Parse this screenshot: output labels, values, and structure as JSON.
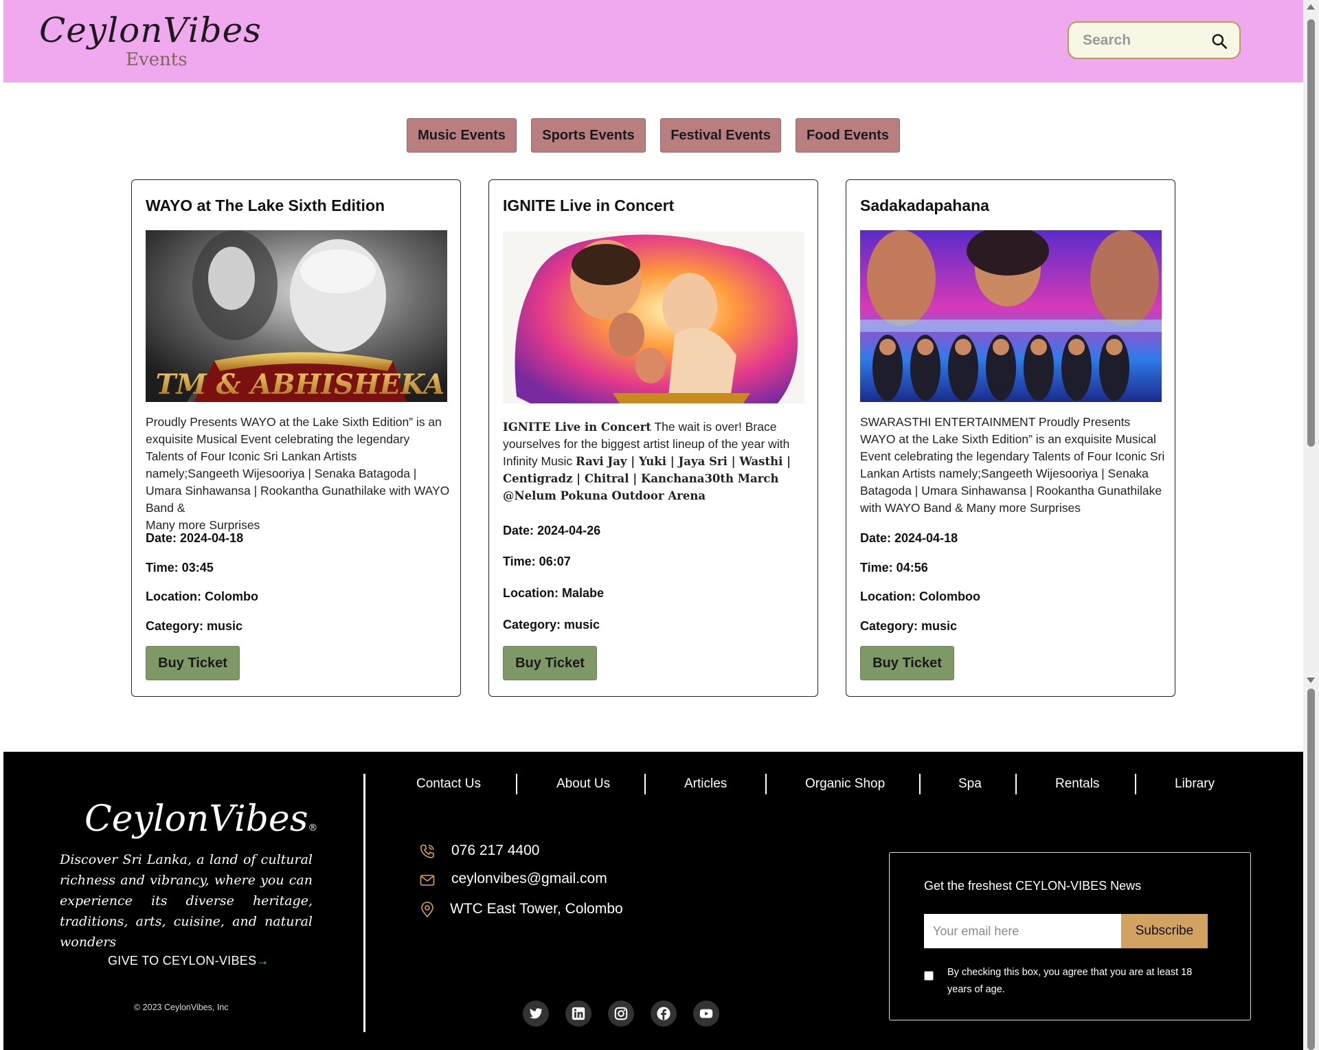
{
  "header": {
    "brand": "CeylonVibes",
    "brand_sub": "Events",
    "search_placeholder": "Search"
  },
  "categories": [
    {
      "label": "Music Events"
    },
    {
      "label": "Sports Events"
    },
    {
      "label": "Festival Events"
    },
    {
      "label": "Food Events"
    }
  ],
  "events": [
    {
      "title": "WAYO at The Lake Sixth Edition",
      "image_caption": "TM & ABHISHEKA",
      "description": "Proudly Presents WAYO at the Lake Sixth Edition” is an exquisite Musical Event celebrating the legendary Talents of Four Iconic Sri Lankan Artists namely;Sangeeth Wijesooriya | Senaka Batagoda | Umara Sinhawansa | Rookantha Gunathilake with WAYO Band &",
      "description_tail": "Many more Surprises",
      "date": "Date: 2024-04-18",
      "time": "Time: 03:45",
      "location": "Location: Colombo",
      "category": "Category: music",
      "button": "Buy Ticket"
    },
    {
      "title": "IGNITE Live in Concert",
      "desc_lead_bold": "IGNITE Live in Concert",
      "desc_lead": " The wait is over! Brace yourselves for the biggest artist lineup of the year with Infinity Music ",
      "desc_bold": "Ravi Jay | Yuki | Jaya Sri | Wasthi | Centigradz | Chitral | Kanchana30th March @Nelum Pokuna Outdoor Arena",
      "date": "Date: 2024-04-26",
      "time": "Time: 06:07",
      "location": "Location: Malabe",
      "category": "Category: music",
      "button": "Buy Ticket"
    },
    {
      "title": "Sadakadapahana",
      "description": "SWARASTHI ENTERTAINMENT Proudly Presents WAYO at the Lake Sixth Edition” is an exquisite Musical Event celebrating the legendary Talents of Four Iconic Sri Lankan Artists namely;Sangeeth Wijesooriya | Senaka Batagoda | Umara Sinhawansa | Rookantha Gunathilake with WAYO Band & Many more Surprises",
      "date": "Date: 2024-04-18",
      "time": "Time: 04:56",
      "location": "Location: Colomboo",
      "category": "Category: music",
      "button": "Buy Ticket"
    }
  ],
  "footer": {
    "brand": "CeylonVibes",
    "brand_mark": "®",
    "tagline": "Discover Sri Lanka, a land of cultural richness and vibrancy, where you can experience its diverse heritage, traditions, arts, cuisine, and natural wonders",
    "give_label": "GIVE TO CEYLON-VIBES",
    "give_arrow": "→",
    "copyright": "© 2023 CeylonVibes, Inc",
    "nav": [
      {
        "label": "Contact Us"
      },
      {
        "label": "About Us"
      },
      {
        "label": "Articles"
      },
      {
        "label": "Organic Shop"
      },
      {
        "label": "Spa"
      },
      {
        "label": "Rentals"
      },
      {
        "label": "Library"
      }
    ],
    "phone": "076 217 4400",
    "email": "ceylonvibes@gmail.com",
    "address": "WTC East Tower, Colombo",
    "social_icons": [
      "twitter-icon",
      "linkedin-icon",
      "instagram-icon",
      "facebook-icon",
      "youtube-icon"
    ],
    "newsletter": {
      "title": "Get the freshest CEYLON-VIBES News",
      "placeholder": "Your email here",
      "button": "Subscribe",
      "legal": "By checking this box, you agree that you are at least 18 years of age."
    }
  },
  "colors": {
    "header_bg": "#f0a8ee",
    "category_button": "#b97e7e",
    "buy_button": "#7e9868",
    "subscribe_button": "#d2a262",
    "footer_bg": "#000000",
    "accent_icon": "#e0a44a"
  }
}
